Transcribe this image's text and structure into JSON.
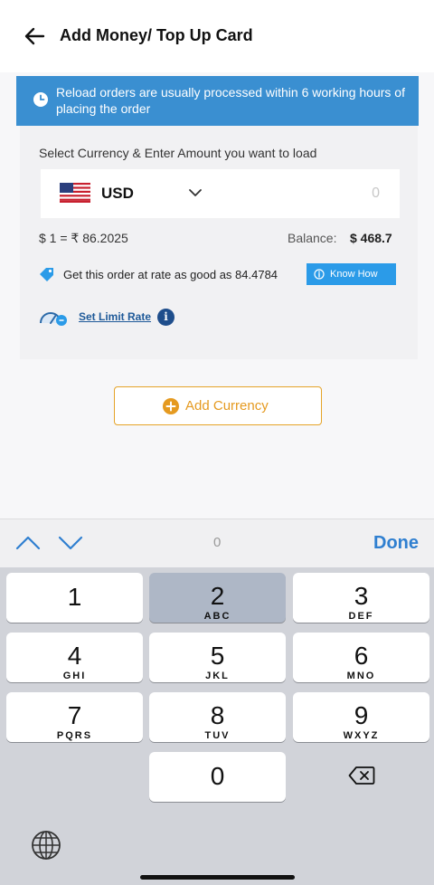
{
  "header": {
    "title": "Add Money/ Top Up Card",
    "back_icon": "arrow-left-icon"
  },
  "info_banner": {
    "text": "Reload orders are usually processed within 6 working hours of placing the order",
    "icon": "clock-icon",
    "color": "#3a8fd1"
  },
  "load_card": {
    "label": "Select Currency & Enter Amount you want to load",
    "currency": {
      "code": "USD",
      "flag": "us-flag-icon"
    },
    "amount_value": "0",
    "rate_text": "$ 1 = ₹ 86.2025",
    "balance_label": "Balance:",
    "balance_value": "$ 468.7",
    "offer_text": "Get this order at rate as good as 84.4784",
    "know_how_label": "Know How",
    "set_limit_label": "Set Limit Rate"
  },
  "add_currency_label": "Add Currency",
  "accessory_bar": {
    "field_value": "0",
    "done_label": "Done"
  },
  "keyboard": {
    "keys": [
      {
        "num": "1",
        "letters": ""
      },
      {
        "num": "2",
        "letters": "ABC"
      },
      {
        "num": "3",
        "letters": "DEF"
      },
      {
        "num": "4",
        "letters": "GHI"
      },
      {
        "num": "5",
        "letters": "JKL"
      },
      {
        "num": "6",
        "letters": "MNO"
      },
      {
        "num": "7",
        "letters": "PQRS"
      },
      {
        "num": "8",
        "letters": "TUV"
      },
      {
        "num": "9",
        "letters": "WXYZ"
      },
      {
        "num": "0",
        "letters": ""
      }
    ]
  },
  "colors": {
    "accent_blue": "#2b9be8",
    "orange": "#e5a328",
    "done_blue": "#2f7fd0"
  }
}
